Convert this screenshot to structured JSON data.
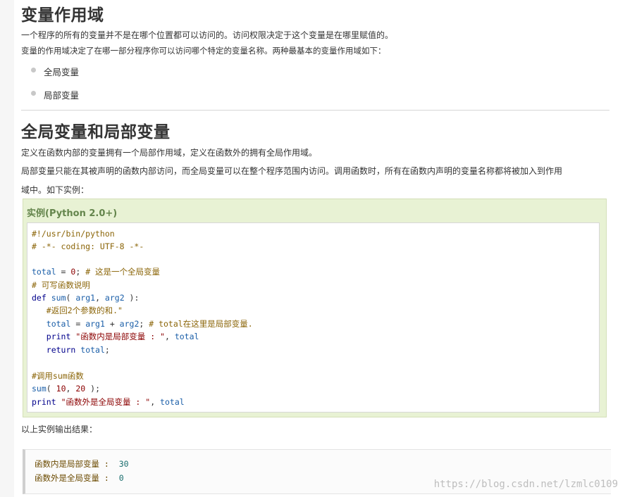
{
  "sections": {
    "scope_title": "变量作用域",
    "scope_p1": "一个程序的所有的变量并不是在哪个位置都可以访问的。访问权限决定于这个变量是在哪里赋值的。",
    "scope_p2": "变量的作用域决定了在哪一部分程序你可以访问哪个特定的变量名称。两种最基本的变量作用域如下：",
    "bullets": [
      "全局变量",
      "局部变量"
    ],
    "gl_title": "全局变量和局部变量",
    "gl_p1": "定义在函数内部的变量拥有一个局部作用域，定义在函数外的拥有全局作用域。",
    "gl_p2a": "局部变量只能在其被声明的函数内部访问，而全局变量可以在整个程序范围内访问。调用函数时，所有在函数内声明的变量名称都将被加入到作用",
    "gl_p2b": "域中。如下实例：",
    "result_label": "以上实例输出结果："
  },
  "example": {
    "title": "实例(Python 2.0+)",
    "code": [
      "#!/usr/bin/python",
      "# -*- coding: UTF-8 -*-",
      "",
      "total = 0; # 这是一个全局变量",
      "# 可写函数说明",
      "def sum( arg1, arg2 ):",
      "   #返回2个参数的和.\"",
      "   total = arg1 + arg2; # total在这里是局部变量.",
      "   print \"函数内是局部变量 : \", total",
      "   return total;",
      "",
      "#调用sum函数",
      "sum( 10, 20 );",
      "print \"函数外是全局变量 : \", total"
    ]
  },
  "output": {
    "lines": [
      {
        "label": "函数内是局部变量 :  ",
        "value": "30"
      },
      {
        "label": "函数外是全局变量 :  ",
        "value": "0"
      }
    ]
  },
  "watermark": "https://blog.csdn.net/lzmlc0109"
}
